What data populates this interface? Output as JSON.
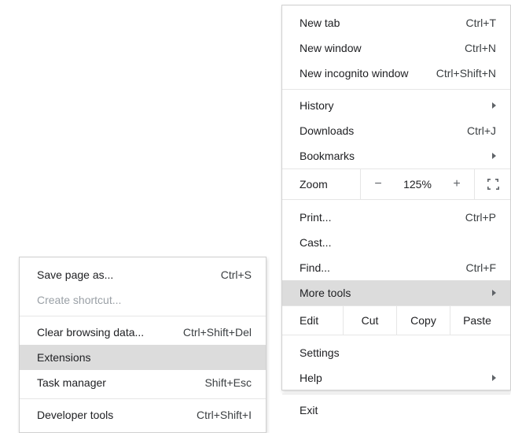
{
  "main_menu": {
    "new_tab": {
      "label": "New tab",
      "shortcut": "Ctrl+T"
    },
    "new_window": {
      "label": "New window",
      "shortcut": "Ctrl+N"
    },
    "new_incognito": {
      "label": "New incognito window",
      "shortcut": "Ctrl+Shift+N"
    },
    "history": {
      "label": "History"
    },
    "downloads": {
      "label": "Downloads",
      "shortcut": "Ctrl+J"
    },
    "bookmarks": {
      "label": "Bookmarks"
    },
    "zoom": {
      "label": "Zoom",
      "minus": "−",
      "value": "125%",
      "plus": "+"
    },
    "print": {
      "label": "Print...",
      "shortcut": "Ctrl+P"
    },
    "cast": {
      "label": "Cast..."
    },
    "find": {
      "label": "Find...",
      "shortcut": "Ctrl+F"
    },
    "more_tools": {
      "label": "More tools"
    },
    "edit": {
      "label": "Edit",
      "cut": "Cut",
      "copy": "Copy",
      "paste": "Paste"
    },
    "settings": {
      "label": "Settings"
    },
    "help": {
      "label": "Help"
    },
    "exit": {
      "label": "Exit"
    }
  },
  "sub_menu": {
    "save_page": {
      "label": "Save page as...",
      "shortcut": "Ctrl+S"
    },
    "create_shortcut": {
      "label": "Create shortcut..."
    },
    "clear_data": {
      "label": "Clear browsing data...",
      "shortcut": "Ctrl+Shift+Del"
    },
    "extensions": {
      "label": "Extensions"
    },
    "task_manager": {
      "label": "Task manager",
      "shortcut": "Shift+Esc"
    },
    "dev_tools": {
      "label": "Developer tools",
      "shortcut": "Ctrl+Shift+I"
    }
  }
}
